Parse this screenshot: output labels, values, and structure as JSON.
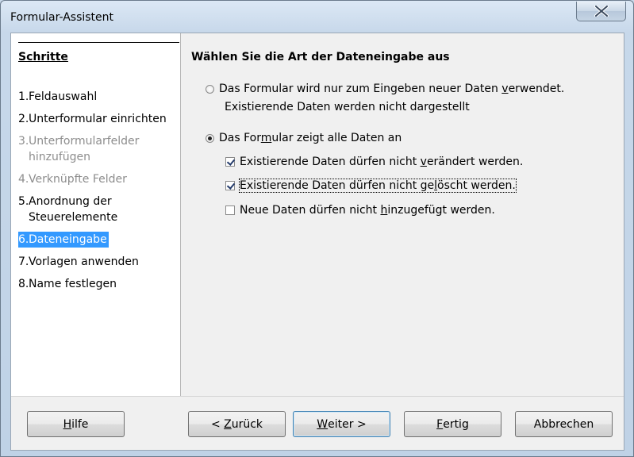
{
  "window": {
    "title": "Formular-Assistent"
  },
  "sidebar": {
    "heading": "Schritte",
    "steps": [
      {
        "num": "1.",
        "label": "Feldauswahl",
        "state": "normal"
      },
      {
        "num": "2.",
        "label": "Unterformular einrichten",
        "state": "normal"
      },
      {
        "num": "3.",
        "label_line1": "Unterformularfelder",
        "label_line2": "hinzufügen",
        "state": "disabled"
      },
      {
        "num": "4.",
        "label": "Verknüpfte Felder",
        "state": "disabled"
      },
      {
        "num": "5.",
        "label_line1": "Anordnung der",
        "label_line2": "Steuerelemente",
        "state": "normal"
      },
      {
        "num": "6.",
        "label": "Dateneingabe",
        "state": "active"
      },
      {
        "num": "7.",
        "label": "Vorlagen anwenden",
        "state": "normal"
      },
      {
        "num": "8.",
        "label": "Name festlegen",
        "state": "normal"
      }
    ]
  },
  "panel": {
    "title": "Wählen Sie die Art der Dateneingabe aus",
    "radio_new_only": {
      "label_pre": "Das Formular wird nur zum Eingeben neuer Daten ",
      "label_mnemonic": "v",
      "label_post": "erwendet.",
      "sub": "Existierende Daten werden nicht dargestellt",
      "selected": false
    },
    "radio_all": {
      "label_pre": "Das For",
      "label_mnemonic": "m",
      "label_post": "ular zeigt alle Daten an",
      "selected": true
    },
    "check_no_modify": {
      "label_pre": "Existierende Daten dürfen nicht ",
      "label_mnemonic": "v",
      "label_post": "erändert werden.",
      "checked": true
    },
    "check_no_delete": {
      "label_pre": "Existierende Daten dürfen nicht ge",
      "label_mnemonic": "l",
      "label_post": "öscht werden.",
      "checked": true
    },
    "check_no_add": {
      "label_pre": "Neue Daten dürfen nicht ",
      "label_mnemonic": "h",
      "label_post": "inzugefügt werden.",
      "checked": false
    }
  },
  "buttons": {
    "help": {
      "mnemonic": "H",
      "rest": "ilfe"
    },
    "back": {
      "pre": "< ",
      "mnemonic": "Z",
      "rest": "urück"
    },
    "next": {
      "mnemonic": "W",
      "rest": "eiter >"
    },
    "finish": {
      "mnemonic": "F",
      "rest": "ertig"
    },
    "cancel": {
      "label": "Abbrechen"
    }
  },
  "colors": {
    "selection": "#3399ff",
    "disabled_text": "#8d8d8d"
  }
}
